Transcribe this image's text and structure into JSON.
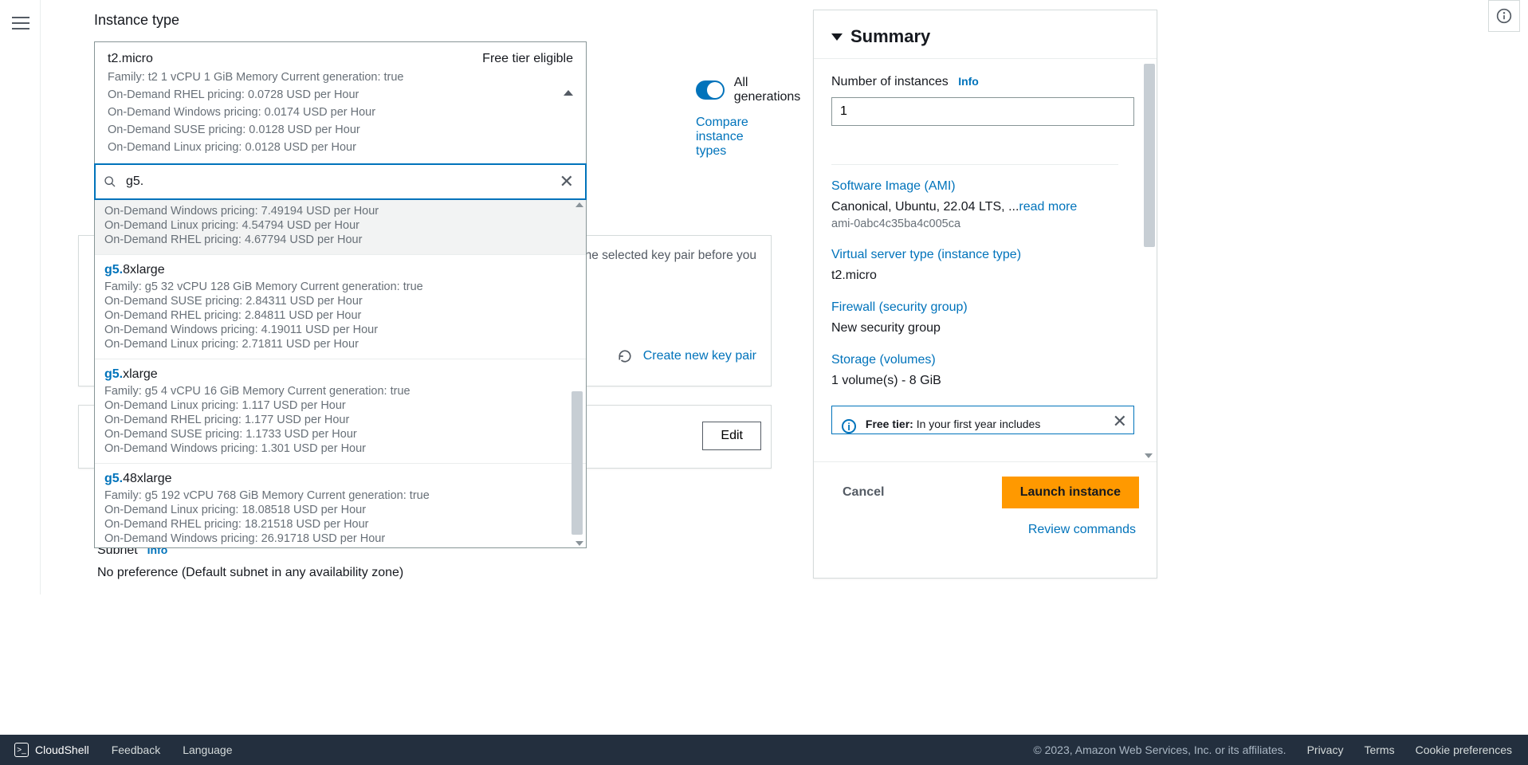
{
  "instanceTypeSection": {
    "title": "Instance type",
    "selected": {
      "name": "t2.micro",
      "freeTier": "Free tier eligible",
      "metaLine": "Family: t2    1 vCPU    1 GiB Memory    Current generation: true",
      "prices": [
        "On-Demand RHEL pricing: 0.0728 USD per Hour",
        "On-Demand Windows pricing: 0.0174 USD per Hour",
        "On-Demand SUSE pricing: 0.0128 USD per Hour",
        "On-Demand Linux pricing: 0.0128 USD per Hour"
      ]
    },
    "searchValue": "g5.",
    "options": [
      {
        "titlePrefix": "",
        "titleSuffix": "",
        "meta": "",
        "prices": [
          "On-Demand Windows pricing: 7.49194 USD per Hour",
          "On-Demand Linux pricing: 4.54794 USD per Hour",
          "On-Demand RHEL pricing: 4.67794 USD per Hour"
        ]
      },
      {
        "titlePrefix": "g5.",
        "titleSuffix": "8xlarge",
        "meta": "Family: g5    32 vCPU    128 GiB Memory    Current generation: true",
        "prices": [
          "On-Demand SUSE pricing: 2.84311 USD per Hour",
          "On-Demand RHEL pricing: 2.84811 USD per Hour",
          "On-Demand Windows pricing: 4.19011 USD per Hour",
          "On-Demand Linux pricing: 2.71811 USD per Hour"
        ]
      },
      {
        "titlePrefix": "g5.",
        "titleSuffix": "xlarge",
        "meta": "Family: g5    4 vCPU    16 GiB Memory    Current generation: true",
        "prices": [
          "On-Demand Linux pricing: 1.117 USD per Hour",
          "On-Demand RHEL pricing: 1.177 USD per Hour",
          "On-Demand SUSE pricing: 1.1733 USD per Hour",
          "On-Demand Windows pricing: 1.301 USD per Hour"
        ]
      },
      {
        "titlePrefix": "g5.",
        "titleSuffix": "48xlarge",
        "meta": "Family: g5    192 vCPU    768 GiB Memory    Current generation: true",
        "prices": [
          "On-Demand Linux pricing: 18.08518 USD per Hour",
          "On-Demand RHEL pricing: 18.21518 USD per Hour",
          "On-Demand Windows pricing: 26.91718 USD per Hour"
        ]
      }
    ],
    "allGenerationsLabel": "All generations",
    "compareLink": "Compare instance types"
  },
  "keyPairHint": "to the selected key pair before you",
  "createKeyPair": "Create new key pair",
  "editLabel": "Edit",
  "subnet": {
    "label": "Subnet",
    "info": "Info",
    "value": "No preference (Default subnet in any availability zone)"
  },
  "summary": {
    "title": "Summary",
    "numInstancesLabel": "Number of instances",
    "info": "Info",
    "numInstances": "1",
    "amiLabel": "Software Image (AMI)",
    "amiText": "Canonical, Ubuntu, 22.04 LTS, ...",
    "readMore": "read more",
    "amiId": "ami-0abc4c35ba4c005ca",
    "serverTypeLabel": "Virtual server type (instance type)",
    "serverType": "t2.micro",
    "firewallLabel": "Firewall (security group)",
    "firewallValue": "New security group",
    "storageLabel": "Storage (volumes)",
    "storageValue": "1 volume(s) - 8 GiB",
    "freeTierTitle": "Free tier:",
    "freeTierText": " In your first year includes",
    "cancel": "Cancel",
    "launch": "Launch instance",
    "review": "Review commands"
  },
  "footer": {
    "cloudshell": "CloudShell",
    "feedback": "Feedback",
    "language": "Language",
    "copyright": "© 2023, Amazon Web Services, Inc. or its affiliates.",
    "privacy": "Privacy",
    "terms": "Terms",
    "cookies": "Cookie preferences"
  }
}
